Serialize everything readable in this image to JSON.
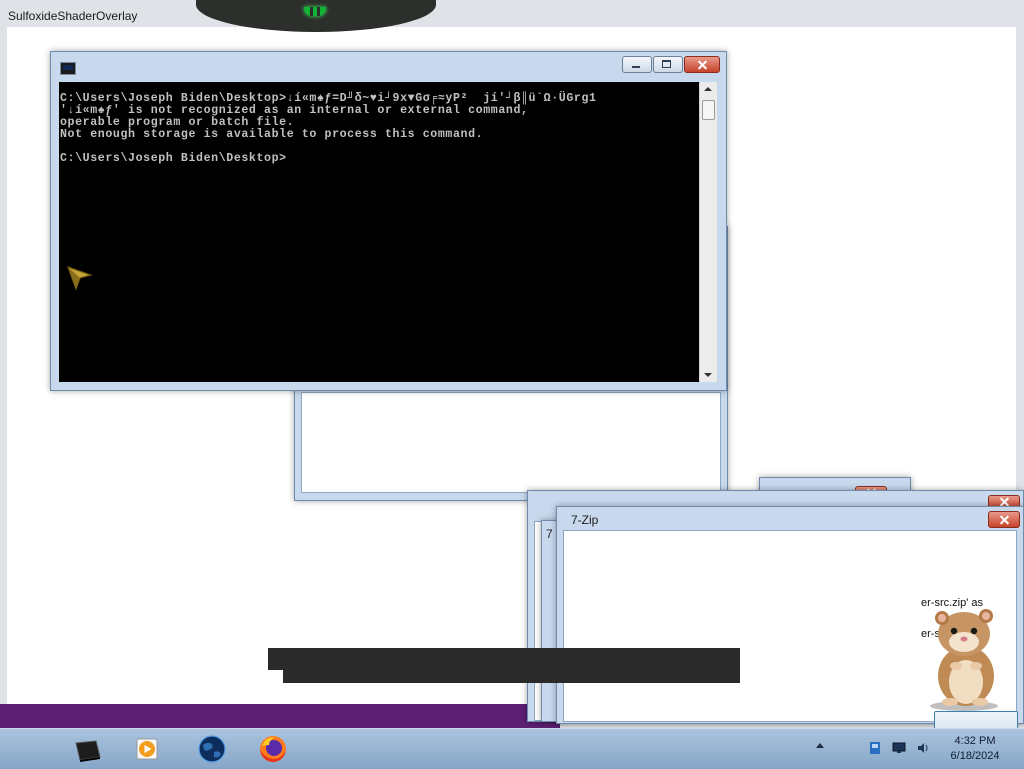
{
  "overlay": {
    "title": "SulfoxideShaderOverlay"
  },
  "cmd": {
    "lines": [
      "C:\\Users\\Joseph Biden\\Desktop>↓í«m♠ƒ=D╜δ~♥i┘9x▼Gσ╒≈yP²  jí'┘β║ü`Ω·ÜGrg1",
      "'↓í«m♠ƒ' is not recognized as an internal or external command,",
      "operable program or batch file.",
      "Not enough storage is available to process this command.",
      "",
      "C:\\Users\\Joseph Biden\\Desktop>"
    ]
  },
  "zip": {
    "title": "7-Zip",
    "line1": "er-src.zip' as",
    "line2": "er-src.zip",
    "stack_label_a": "7",
    "stack_label_b": "7"
  },
  "taskbar": {
    "apps": [
      "show-desktop-icon",
      "media-player-icon",
      "earth-browser-icon",
      "firefox-icon"
    ],
    "clock_time": "4:32 PM",
    "clock_date": "6/18/2024"
  },
  "colors": {
    "accent_purple": "#5c1f73",
    "notch_green": "#13b335",
    "cmd_bg": "#000000"
  }
}
